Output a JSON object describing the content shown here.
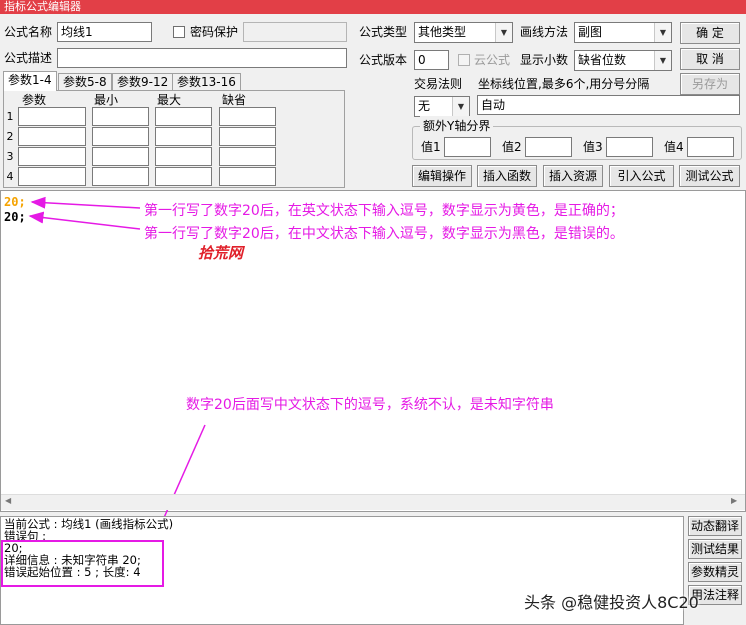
{
  "window": {
    "title": "指标公式编辑器"
  },
  "form": {
    "name_label": "公式名称",
    "name_value": "均线1",
    "password_label": "密码保护",
    "desc_label": "公式描述",
    "type_label": "公式类型",
    "type_value": "其他类型",
    "draw_label": "画线方法",
    "draw_value": "副图",
    "version_label": "公式版本",
    "version_value": "0",
    "cloud_label": "云公式",
    "decimal_label": "显示小数",
    "decimal_value": "缺省位数",
    "trade_rule_label": "交易法则",
    "trade_rule_value": "无",
    "coord_label": "坐标线位置,最多6个,用分号分隔",
    "coord_value": "自动",
    "y_axis_group": "额外Y轴分界",
    "values": [
      "值1",
      "值2",
      "值3",
      "值4"
    ]
  },
  "buttons": {
    "ok": "确  定",
    "cancel": "取  消",
    "save_as": "另存为",
    "edit_op": "编辑操作",
    "insert_func": "插入函数",
    "insert_res": "插入资源",
    "import": "引入公式",
    "test": "测试公式"
  },
  "param_tabs": [
    "参数1-4",
    "参数5-8",
    "参数9-12",
    "参数13-16"
  ],
  "param_headers": [
    "参数",
    "最小",
    "最大",
    "缺省"
  ],
  "param_rows": [
    "1",
    "2",
    "3",
    "4"
  ],
  "editor": {
    "line1": "20;",
    "line2": "20;",
    "line1_color": "#f5a300"
  },
  "annotations": {
    "note1": "第一行写了数字20后，在英文状态下输入逗号，数字显示为黄色，是正确的；",
    "note2": "第一行写了数字20后，在中文状态下输入逗号，数字显示为黑色，是错误的。",
    "brand": "拾荒网",
    "note3": "数字20后面写中文状态下的逗号，系统不认，是未知字符串",
    "watermark": "头条 @稳健投资人8C20"
  },
  "output": {
    "line1": "当前公式 : 均线1 (画线指标公式)",
    "line2": "错误句 :",
    "line3": "20;",
    "line4": "详细信息 : 未知字符串 20;",
    "line5": "错误起始位置 : 5 ; 长度: 4"
  },
  "side_buttons": [
    "动态翻译",
    "测试结果",
    "参数精灵",
    "用法注释"
  ],
  "colors": {
    "titlebar": "#e23f47",
    "annotation": "#e51ae5",
    "highlight_box": "#e51ae5"
  }
}
